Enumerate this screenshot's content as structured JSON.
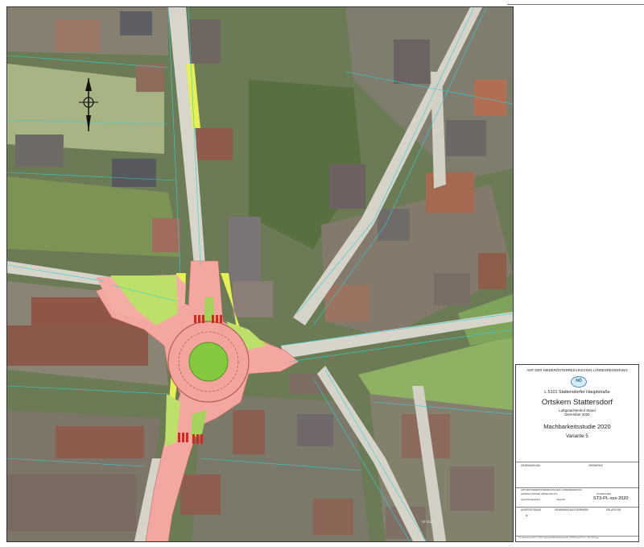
{
  "map": {
    "features": {
      "north_arrow": "north-arrow-icon",
      "roundabout_island_color": "#83c93e",
      "proposed_area_color": "#f4a7a0",
      "shoulder_color": "#e6ef54",
      "field_color": "#9cbc6e",
      "road_color": "#d6d3c9"
    },
    "small_labels": {
      "left_road_number": "",
      "bottom_label": "ST 202"
    }
  },
  "titleblock": {
    "agency": "AMT DER NIEDERÖSTERREICHISCHEN LANDESREGIERUNG",
    "agency_sub": "Gruppe Straße, Abteilung Landesstraßenplanung – ST3",
    "logo_text": "NÖ",
    "road": "L 5101 Stattersdorfer Hauptstraße",
    "title": "Ortskern Stattersdorf",
    "client_line1": "Luftgutachtenhof Stand",
    "client_line2": "Dezember 2020",
    "study": "Machbarkeitsstudie 2020",
    "variant": "Variante 5",
    "field_genehmigung": "GENEHMIGUNG",
    "field_vermerke": "VERMERKE",
    "field_amt": "AMT DER NIEDERÖSTERREICHISCHEN LANDESREGIERUNG",
    "field_gruppe": "GRUPPE STRASSE, ABTEILUNG ST3",
    "field_planzeichen": "PLANZEICHEN",
    "plan_number": "ST3-PL-xxx-2020",
    "field_bearbeitet": "Gezeichnet/geändert",
    "field_geprueft": "Überprüft",
    "field_ausfertigung": "AUSFERTIGUNG",
    "ausfertigung_value": "A",
    "field_genehmigungsvermerk": "GENEHMIGUNGSVERMERK",
    "field_erlass": "ERLASS NR.",
    "file_path": "P:\\Landesstrassen\\ST3_L5101_Stattersdorf\\Machbarkeitsstudie_2020\\Plaene\\ST3_PL_V05_2020.dwg"
  }
}
